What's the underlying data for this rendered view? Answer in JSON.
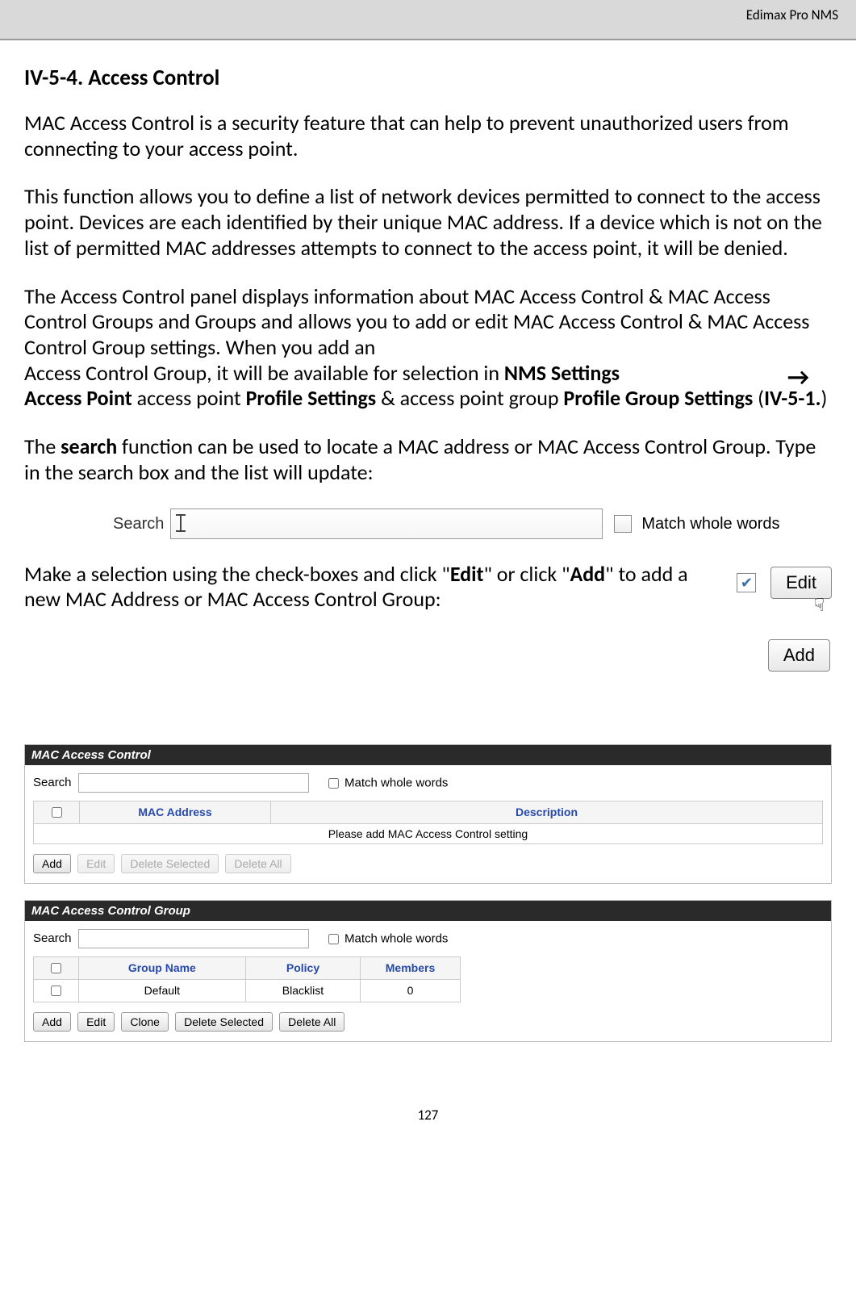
{
  "header": {
    "product": "Edimax Pro NMS"
  },
  "section": {
    "number": "IV-5-4.",
    "title": "Access Control"
  },
  "para1": "MAC Access Control is a security feature that can help to prevent unauthorized users from connecting to your access point.",
  "para2": "This function allows you to define a list of network devices permitted to connect to the access point. Devices are each identified by their unique MAC address. If a device which is not on the list of permitted MAC addresses attempts to connect to the access point, it will be denied.",
  "para3_a": "The Access Control panel displays information about MAC Access Control & MAC Access Control Groups and Groups and allows you to add or edit MAC Access Control & MAC Access Control Group settings. When you add an",
  "para3_b_pre": "Access Control Group, it will be available for selection in ",
  "para3_b_bold1": "NMS Settings",
  "para3_c_bold": "Access Point",
  "para3_c_mid": " access point ",
  "para3_c_bold2": "Profile Settings",
  "para3_c_mid2": " & access point group ",
  "para3_c_bold3": "Profile Group Settings",
  "para3_c_end": " (",
  "para3_c_bold4": "IV-5-1.",
  "para3_c_close": ")",
  "arrow": "→",
  "para4_a": "The ",
  "para4_bold": "search",
  "para4_b": " function can be used to locate a MAC address or MAC Access Control Group. Type in the search box and the list will update:",
  "search_fig": {
    "label": "Search",
    "match": "Match whole words"
  },
  "para5_a": "Make a selection using the check-boxes and click \"",
  "para5_bold1": "Edit",
  "para5_mid": "\" or click \"",
  "para5_bold2": "Add",
  "para5_end": "\" to add a new MAC Address or MAC Access Control Group:",
  "buttons_fig": {
    "edit": "Edit",
    "add": "Add",
    "check": "✔"
  },
  "panel1": {
    "title": "MAC Access Control",
    "search_label": "Search",
    "match_label": "Match whole words",
    "cols": [
      "MAC Address",
      "Description"
    ],
    "empty_msg": "Please add MAC Access Control setting",
    "buttons": [
      "Add",
      "Edit",
      "Delete Selected",
      "Delete All"
    ]
  },
  "panel2": {
    "title": "MAC Access Control Group",
    "search_label": "Search",
    "match_label": "Match whole words",
    "cols": [
      "Group Name",
      "Policy",
      "Members"
    ],
    "rows": [
      {
        "name": "Default",
        "policy": "Blacklist",
        "members": "0"
      }
    ],
    "buttons": [
      "Add",
      "Edit",
      "Clone",
      "Delete Selected",
      "Delete All"
    ]
  },
  "page_number": "127"
}
